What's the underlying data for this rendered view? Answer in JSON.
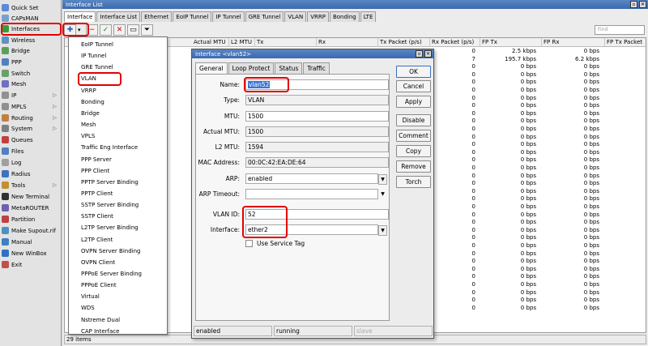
{
  "sidebar": {
    "items": [
      {
        "label": "Quick Set",
        "icon": "quickset-icon",
        "color": "#5a8ad8",
        "arrow": false
      },
      {
        "label": "CAPsMAN",
        "icon": "capsman-icon",
        "color": "#7aa0d0",
        "arrow": false
      },
      {
        "label": "Interfaces",
        "icon": "interfaces-icon",
        "color": "#3a9a3a",
        "arrow": false
      },
      {
        "label": "Wireless",
        "icon": "wireless-icon",
        "color": "#6090c0",
        "arrow": false
      },
      {
        "label": "Bridge",
        "icon": "bridge-icon",
        "color": "#5aa05a",
        "arrow": false
      },
      {
        "label": "PPP",
        "icon": "ppp-icon",
        "color": "#5080c0",
        "arrow": false
      },
      {
        "label": "Switch",
        "icon": "switch-icon",
        "color": "#6aa06a",
        "arrow": false
      },
      {
        "label": "Mesh",
        "icon": "mesh-icon",
        "color": "#7070c0",
        "arrow": false
      },
      {
        "label": "IP",
        "icon": "ip-icon",
        "color": "#909090",
        "arrow": true
      },
      {
        "label": "MPLS",
        "icon": "mpls-icon",
        "color": "#909090",
        "arrow": true
      },
      {
        "label": "Routing",
        "icon": "routing-icon",
        "color": "#c08040",
        "arrow": true
      },
      {
        "label": "System",
        "icon": "system-icon",
        "color": "#808080",
        "arrow": true
      },
      {
        "label": "Queues",
        "icon": "queues-icon",
        "color": "#c04040",
        "arrow": false
      },
      {
        "label": "Files",
        "icon": "files-icon",
        "color": "#5080c0",
        "arrow": false
      },
      {
        "label": "Log",
        "icon": "log-icon",
        "color": "#a0a0a0",
        "arrow": false
      },
      {
        "label": "Radius",
        "icon": "radius-icon",
        "color": "#4070c0",
        "arrow": false
      },
      {
        "label": "Tools",
        "icon": "tools-icon",
        "color": "#c09030",
        "arrow": true
      },
      {
        "label": "New Terminal",
        "icon": "terminal-icon",
        "color": "#303030",
        "arrow": false
      },
      {
        "label": "MetaROUTER",
        "icon": "metarouter-icon",
        "color": "#7060b0",
        "arrow": false
      },
      {
        "label": "Partition",
        "icon": "partition-icon",
        "color": "#c04040",
        "arrow": false
      },
      {
        "label": "Make Supout.rif",
        "icon": "supout-icon",
        "color": "#5090c0",
        "arrow": false
      },
      {
        "label": "Manual",
        "icon": "manual-icon",
        "color": "#4080c0",
        "arrow": false
      },
      {
        "label": "New WinBox",
        "icon": "winbox-icon",
        "color": "#3070c0",
        "arrow": false
      },
      {
        "label": "Exit",
        "icon": "exit-icon",
        "color": "#c05050",
        "arrow": false
      }
    ]
  },
  "window": {
    "title": "Interface List",
    "tabs": [
      "Interface",
      "Interface List",
      "Ethernet",
      "EoIP Tunnel",
      "IP Tunnel",
      "GRE Tunnel",
      "VLAN",
      "VRRP",
      "Bonding",
      "LTE"
    ],
    "find_placeholder": "Find",
    "columns": [
      "Actual MTU",
      "L2 MTU",
      "Tx",
      "Rx",
      "Tx Packet (p/s)",
      "Rx Packet (p/s)",
      "FP Tx",
      "FP Rx",
      "FP Tx Packet"
    ],
    "rows": [
      {
        "rxp": "0",
        "fptx": "2.5 kbps",
        "fprx": "0 bps"
      },
      {
        "rxp": "7",
        "fptx": "195.7 kbps",
        "fprx": "6.2 kbps"
      },
      {
        "rxp": "0",
        "fptx": "0 bps",
        "fprx": "0 bps"
      },
      {
        "rxp": "0",
        "fptx": "0 bps",
        "fprx": "0 bps"
      },
      {
        "rxp": "0",
        "fptx": "0 bps",
        "fprx": "0 bps"
      },
      {
        "rxp": "0",
        "fptx": "0 bps",
        "fprx": "0 bps"
      },
      {
        "rxp": "0",
        "fptx": "0 bps",
        "fprx": "0 bps"
      },
      {
        "rxp": "0",
        "fptx": "0 bps",
        "fprx": "0 bps"
      },
      {
        "rxp": "0",
        "fptx": "0 bps",
        "fprx": "0 bps"
      },
      {
        "rxp": "0",
        "fptx": "0 bps",
        "fprx": "0 bps"
      },
      {
        "rxp": "0",
        "fptx": "0 bps",
        "fprx": "0 bps"
      },
      {
        "rxp": "0",
        "fptx": "0 bps",
        "fprx": "0 bps"
      },
      {
        "rxp": "0",
        "fptx": "0 bps",
        "fprx": "0 bps"
      },
      {
        "rxp": "0",
        "fptx": "0 bps",
        "fprx": "0 bps"
      },
      {
        "rxp": "0",
        "fptx": "0 bps",
        "fprx": "0 bps"
      },
      {
        "rxp": "0",
        "fptx": "0 bps",
        "fprx": "0 bps"
      },
      {
        "rxp": "0",
        "fptx": "0 bps",
        "fprx": "0 bps"
      },
      {
        "rxp": "0",
        "fptx": "0 bps",
        "fprx": "0 bps"
      },
      {
        "rxp": "0",
        "fptx": "0 bps",
        "fprx": "0 bps"
      },
      {
        "rxp": "0",
        "fptx": "0 bps",
        "fprx": "0 bps"
      },
      {
        "rxp": "0",
        "fptx": "0 bps",
        "fprx": "0 bps"
      },
      {
        "rxp": "0",
        "fptx": "0 bps",
        "fprx": "0 bps"
      },
      {
        "rxp": "0",
        "fptx": "0 bps",
        "fprx": "0 bps"
      },
      {
        "rxp": "0",
        "fptx": "0 bps",
        "fprx": "0 bps"
      },
      {
        "rxp": "0",
        "fptx": "0 bps",
        "fprx": "0 bps"
      },
      {
        "rxp": "0",
        "fptx": "0 bps",
        "fprx": "0 bps"
      },
      {
        "rxp": "0",
        "fptx": "0 bps",
        "fprx": "0 bps"
      },
      {
        "rxp": "0",
        "fptx": "0 bps",
        "fprx": "0 bps"
      },
      {
        "rxp": "0",
        "fptx": "0 bps",
        "fprx": "0 bps"
      },
      {
        "rxp": "0",
        "fptx": "0 bps",
        "fprx": "0 bps"
      },
      {
        "rxp": "0",
        "fptx": "0 bps",
        "fprx": "0 bps"
      },
      {
        "rxp": "0",
        "fptx": "0 bps",
        "fprx": "0 bps"
      },
      {
        "rxp": "0",
        "fptx": "0 bps",
        "fprx": "0 bps"
      },
      {
        "rxp": "0",
        "fptx": "0 bps",
        "fprx": "0 bps"
      }
    ],
    "item_count": "29 items"
  },
  "menu": {
    "items": [
      "EoIP Tunnel",
      "IP Tunnel",
      "GRE Tunnel",
      "VLAN",
      "VRRP",
      "Bonding",
      "Bridge",
      "Mesh",
      "VPLS",
      "Traffic Eng Interface",
      "PPP Server",
      "PPP Client",
      "PPTP Server Binding",
      "PPTP Client",
      "SSTP Server Binding",
      "SSTP Client",
      "L2TP Server Binding",
      "L2TP Client",
      "OVPN Server Binding",
      "OVPN Client",
      "PPPoE Server Binding",
      "PPPoE Client",
      "Virtual",
      "WDS",
      "Nstreme Dual",
      "CAP Interface"
    ]
  },
  "dialog": {
    "title": "Interface <vlan52>",
    "tabs": [
      "General",
      "Loop Protect",
      "Status",
      "Traffic"
    ],
    "fields": {
      "name_label": "Name:",
      "name": "vlan52",
      "type_label": "Type:",
      "type": "VLAN",
      "mtu_label": "MTU:",
      "mtu": "1500",
      "actual_mtu_label": "Actual MTU:",
      "actual_mtu": "1500",
      "l2mtu_label": "L2 MTU:",
      "l2mtu": "1594",
      "mac_label": "MAC Address:",
      "mac": "00:0C:42:EA:DE:64",
      "arp_label": "ARP:",
      "arp": "enabled",
      "arp_timeout_label": "ARP Timeout:",
      "arp_timeout": "",
      "vlan_id_label": "VLAN ID:",
      "vlan_id": "52",
      "interface_label": "Interface:",
      "interface": "ether2",
      "service_tag_label": "Use Service Tag"
    },
    "buttons": [
      "OK",
      "Cancel",
      "Apply",
      "Disable",
      "Comment",
      "Copy",
      "Remove",
      "Torch"
    ],
    "status": [
      "enabled",
      "running",
      "slave"
    ]
  },
  "colors": {
    "highlight": "#e30000",
    "titlebar": "#4a78bb",
    "selection": "#3875d7"
  }
}
